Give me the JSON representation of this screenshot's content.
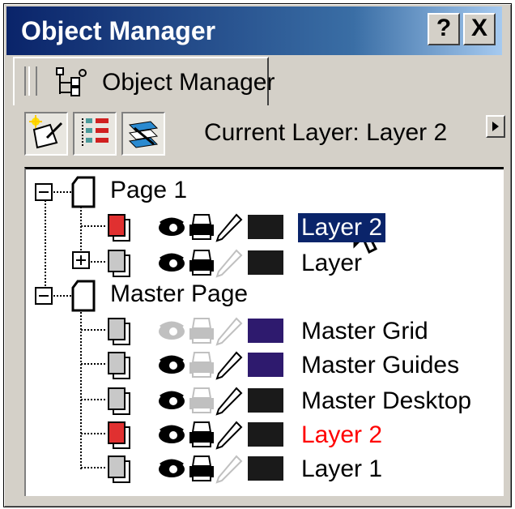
{
  "window": {
    "title": "Object Manager",
    "help_button": "?",
    "close_button": "X"
  },
  "tab": {
    "label": "Object Manager"
  },
  "toolbar": {
    "current_layer_text": "Current Layer: Layer 2",
    "buttons": [
      "new-layer-icon",
      "show-properties-icon",
      "edit-across-layers-icon"
    ]
  },
  "tree": {
    "pages": [
      {
        "label": "Page 1",
        "expanded": true,
        "layers": [
          {
            "label": "Layer 2",
            "selected": true,
            "visible": true,
            "printable": true,
            "editable": true,
            "color": "#1a1a1a"
          },
          {
            "label": "Layer",
            "selected": false,
            "visible": true,
            "printable": true,
            "editable": false,
            "color": "#1a1a1a"
          }
        ]
      },
      {
        "label": "Master Page",
        "expanded": true,
        "layers": [
          {
            "label": "Master Grid",
            "visible": false,
            "printable": false,
            "editable": false,
            "color": "#2e1a6e"
          },
          {
            "label": "Master Guides",
            "visible": true,
            "printable": false,
            "editable": true,
            "color": "#2e1a6e"
          },
          {
            "label": "Master Desktop",
            "visible": true,
            "printable": false,
            "editable": true,
            "color": "#1a1a1a"
          },
          {
            "label": "Layer 2",
            "visible": true,
            "printable": true,
            "editable": true,
            "color": "#1a1a1a",
            "text_color": "#ff0000"
          },
          {
            "label": "Layer 1",
            "visible": true,
            "printable": true,
            "editable": false,
            "color": "#1a1a1a"
          }
        ]
      }
    ]
  }
}
